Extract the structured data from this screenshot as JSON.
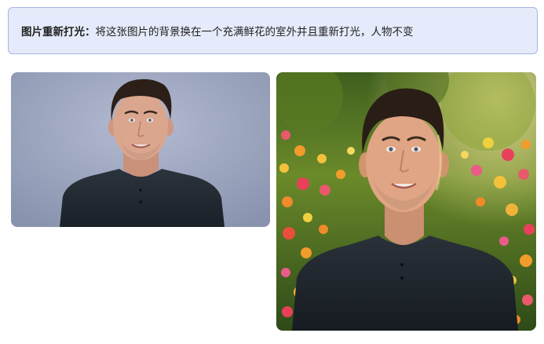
{
  "prompt": {
    "label": "图片重新打光：",
    "text": "将这张图片的背景换在一个充满鲜花的室外并且重新打光，人物不变"
  },
  "images": {
    "original": {
      "subject": "portrait",
      "background": "studio-gray"
    },
    "result": {
      "subject": "portrait",
      "background": "flower-garden"
    }
  },
  "colors": {
    "prompt_bg": "#e6ebfb",
    "prompt_border": "#a6b6e0",
    "studio_bg": "#9aa3bd",
    "shirt": "#222a33",
    "skin": "#d9a48c",
    "hair": "#2c1f18"
  }
}
